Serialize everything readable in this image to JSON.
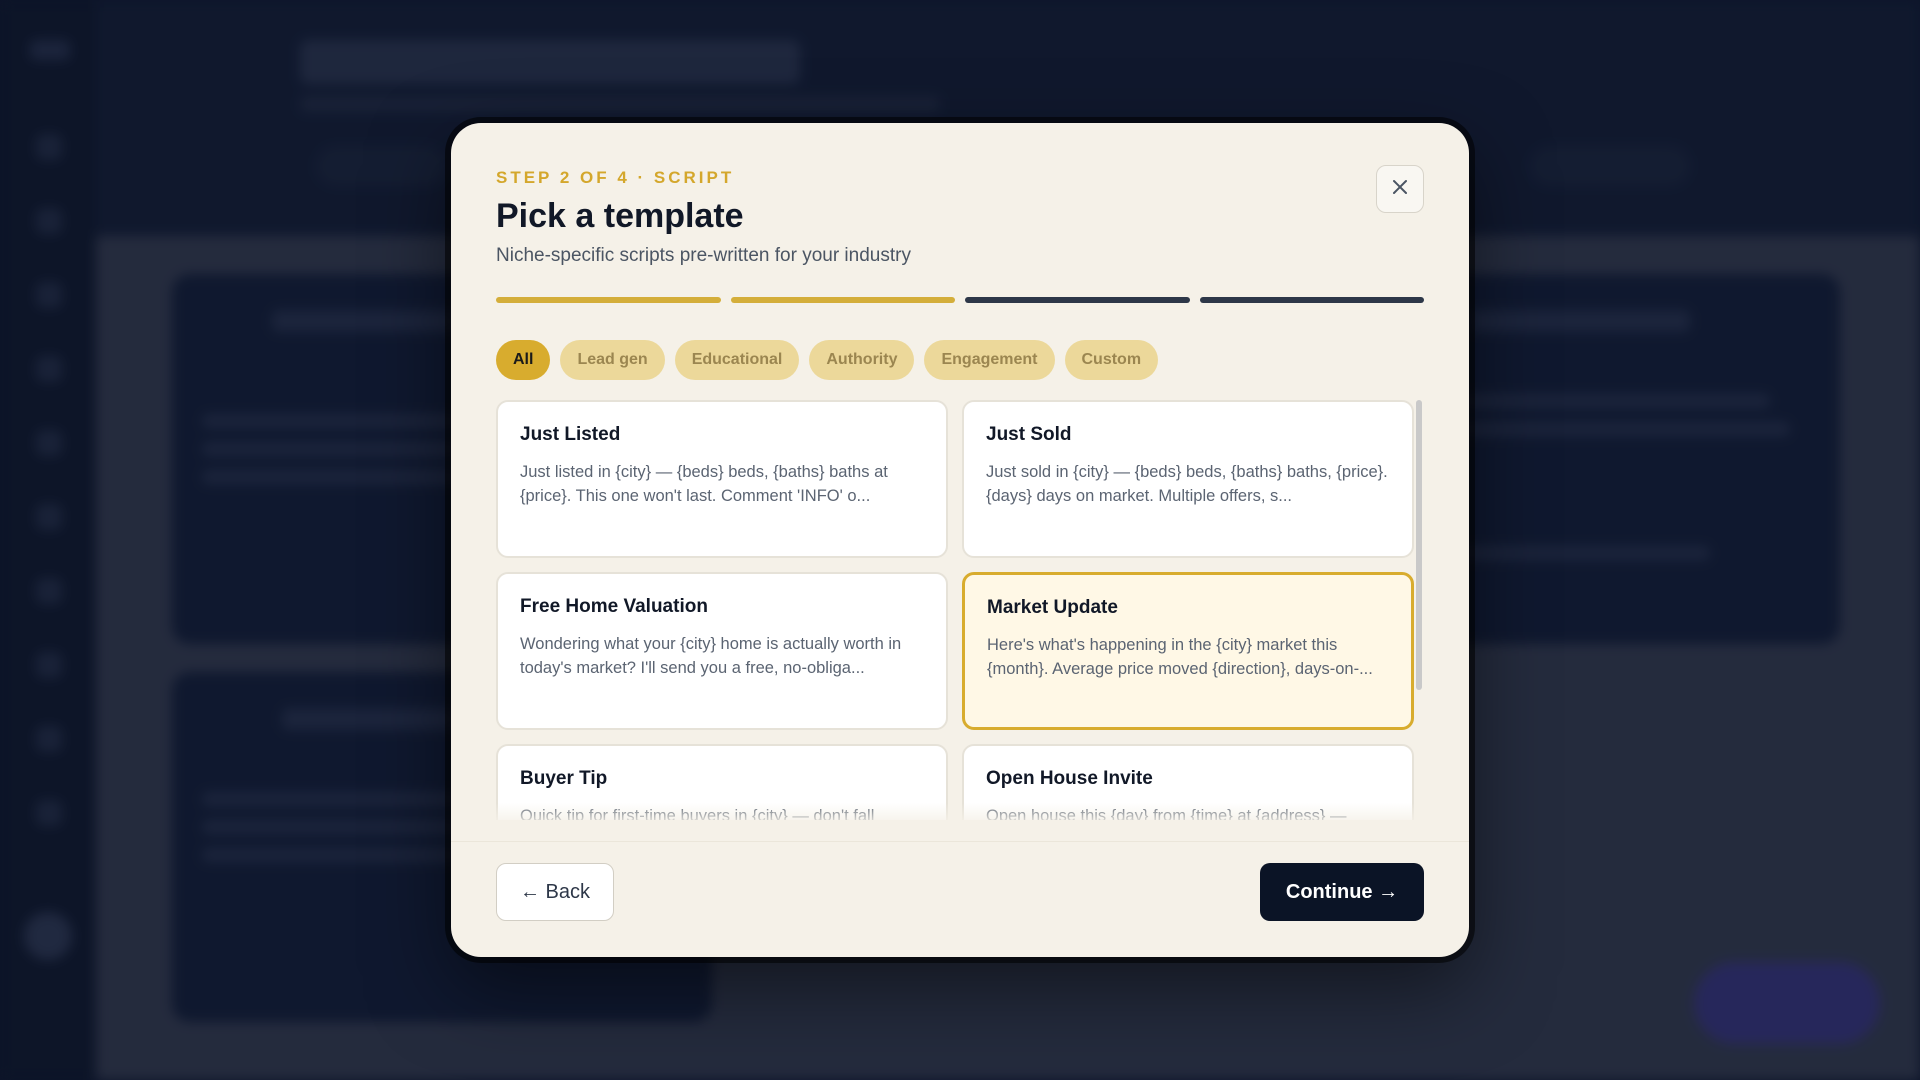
{
  "modal": {
    "step_label": "STEP 2 OF 4 · SCRIPT",
    "title": "Pick a template",
    "subtitle": "Niche-specific scripts pre-written for your industry",
    "close_icon": "close-icon",
    "progress": {
      "total_steps": 4,
      "completed_steps": 2
    },
    "filters": [
      {
        "label": "All",
        "active": true
      },
      {
        "label": "Lead gen",
        "active": false
      },
      {
        "label": "Educational",
        "active": false
      },
      {
        "label": "Authority",
        "active": false
      },
      {
        "label": "Engagement",
        "active": false
      },
      {
        "label": "Custom",
        "active": false
      }
    ],
    "templates": [
      {
        "title": "Just Listed",
        "body": "Just listed in {city} — {beds} beds, {baths} baths at {price}. This one won't last. Comment 'INFO' o...",
        "selected": false
      },
      {
        "title": "Just Sold",
        "body": "Just sold in {city} — {beds} beds, {baths} baths, {price}. {days} days on market. Multiple offers, s...",
        "selected": false
      },
      {
        "title": "Free Home Valuation",
        "body": "Wondering what your {city} home is actually worth in today's market? I'll send you a free, no-obliga...",
        "selected": false
      },
      {
        "title": "Market Update",
        "body": "Here's what's happening in the {city} market this {month}. Average price moved {direction}, days-on-...",
        "selected": true
      },
      {
        "title": "Buyer Tip",
        "body": "Quick tip for first-time buyers in {city} — don't fall",
        "selected": false
      },
      {
        "title": "Open House Invite",
        "body": "Open house this {day} from {time} at {address} —",
        "selected": false
      }
    ],
    "back_label": "← Back",
    "continue_label": "Continue →"
  },
  "colors": {
    "accent": "#d8ac2e",
    "dark": "#0b1426",
    "modal_bg": "#f5f1e8"
  }
}
